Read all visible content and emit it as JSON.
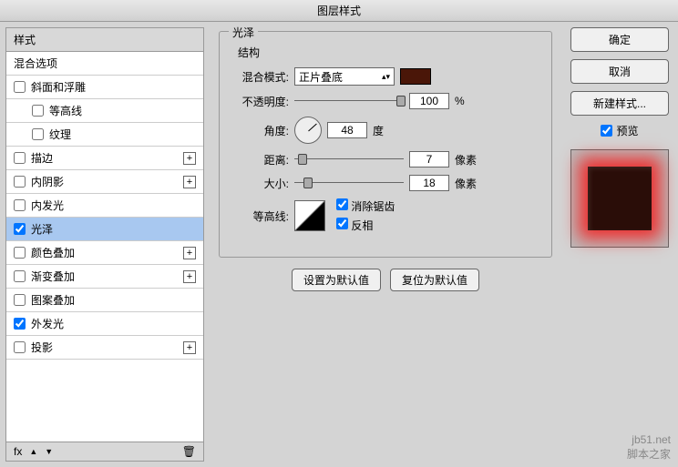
{
  "window": {
    "title": "图层样式"
  },
  "sidebar": {
    "header": "样式",
    "blend_options": "混合选项",
    "items": [
      {
        "label": "斜面和浮雕",
        "checked": false,
        "indent": false,
        "plus": false
      },
      {
        "label": "等高线",
        "checked": false,
        "indent": true,
        "plus": false
      },
      {
        "label": "纹理",
        "checked": false,
        "indent": true,
        "plus": false
      },
      {
        "label": "描边",
        "checked": false,
        "indent": false,
        "plus": true
      },
      {
        "label": "内阴影",
        "checked": false,
        "indent": false,
        "plus": true
      },
      {
        "label": "内发光",
        "checked": false,
        "indent": false,
        "plus": false
      },
      {
        "label": "光泽",
        "checked": true,
        "indent": false,
        "plus": false,
        "selected": true
      },
      {
        "label": "颜色叠加",
        "checked": false,
        "indent": false,
        "plus": true
      },
      {
        "label": "渐变叠加",
        "checked": false,
        "indent": false,
        "plus": true
      },
      {
        "label": "图案叠加",
        "checked": false,
        "indent": false,
        "plus": false
      },
      {
        "label": "外发光",
        "checked": true,
        "indent": false,
        "plus": false
      },
      {
        "label": "投影",
        "checked": false,
        "indent": false,
        "plus": true
      }
    ],
    "fx": "fx"
  },
  "effect": {
    "title": "光泽",
    "structure": "结构",
    "blend_mode_label": "混合模式:",
    "blend_mode_value": "正片叠底",
    "color": "#4a1608",
    "opacity_label": "不透明度:",
    "opacity_value": "100",
    "opacity_unit": "%",
    "angle_label": "角度:",
    "angle_value": "48",
    "angle_unit": "度",
    "distance_label": "距离:",
    "distance_value": "7",
    "distance_unit": "像素",
    "size_label": "大小:",
    "size_value": "18",
    "size_unit": "像素",
    "contour_label": "等高线:",
    "antialias": "消除锯齿",
    "invert": "反相",
    "make_default": "设置为默认值",
    "reset_default": "复位为默认值"
  },
  "right": {
    "ok": "确定",
    "cancel": "取消",
    "new_style": "新建样式...",
    "preview": "预览"
  },
  "watermark": {
    "l1": "jb51.net",
    "l2": "脚本之家"
  },
  "icons": {
    "plus": "+",
    "up": "▲",
    "down": "▼",
    "trash": "🗑",
    "arrows": "▴▾"
  }
}
